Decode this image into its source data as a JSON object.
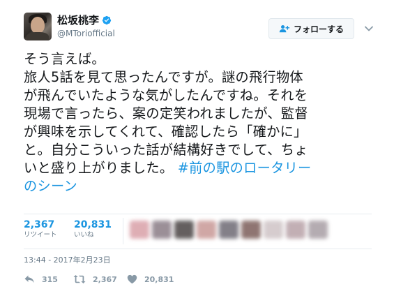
{
  "user": {
    "display_name": "松坂桃李",
    "handle": "@MToriofficial",
    "verified": true
  },
  "follow_button": {
    "label": "フォローする",
    "icon": "add-user-icon"
  },
  "menu_icon": "chevron-down-icon",
  "tweet": {
    "lines": [
      "そう言えば。",
      "旅人5話を見て思ったんですが。謎の飛行物体",
      "が飛んでいたような気がしたんですね。それを",
      "現場で言ったら、案の定笑われましたが、監督",
      "が興味を示してくれて、確認したら「確かに」",
      "と。自分こういった話が結構好きでして、ちょ",
      "いと盛り上がりました。"
    ],
    "hashtag_part1": "#前の駅のロータリー",
    "hashtag_part2": "のシーン"
  },
  "stats": {
    "retweets_count": "2,367",
    "retweets_label": "リツイート",
    "likes_count": "20,831",
    "likes_label": "いいね"
  },
  "timestamp": "13:44 - 2017年2月23日",
  "actions": {
    "reply_count": "315",
    "retweet_count": "2,367",
    "like_count": "20,831"
  },
  "colors": {
    "link": "#1b95e0",
    "muted": "#657786",
    "action_icon": "#8899a6",
    "verified_badge": "#1da1f2"
  }
}
